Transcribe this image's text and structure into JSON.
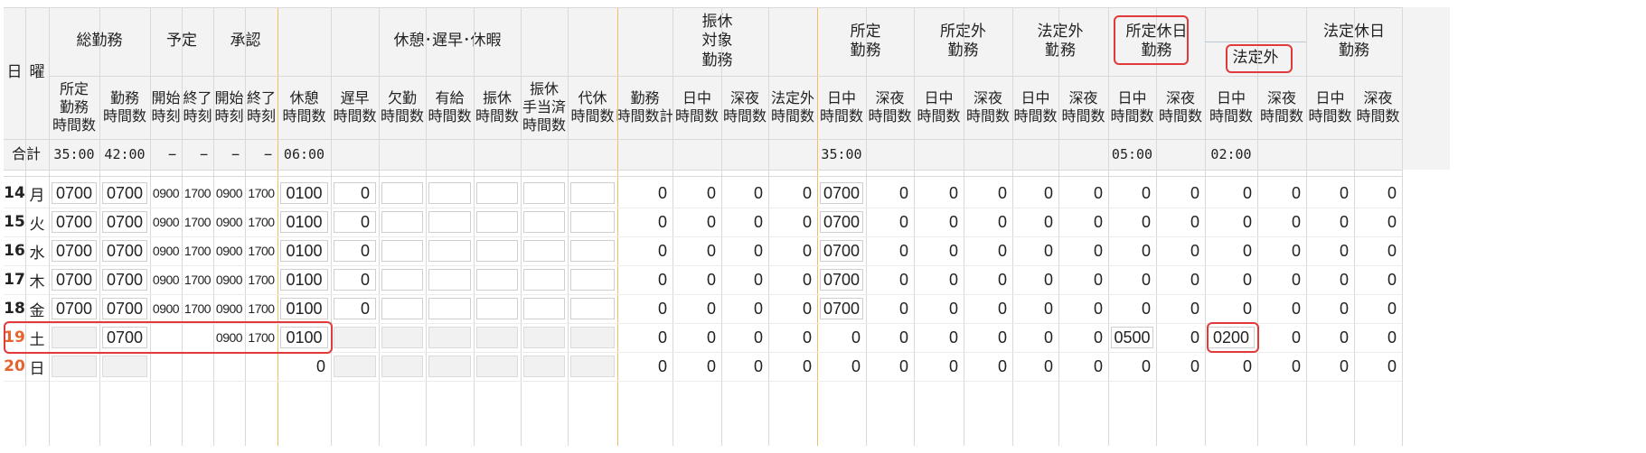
{
  "headers": {
    "day": "日",
    "weekday": "曜",
    "total_work": "総勤務",
    "scheduled": "予定",
    "approval": "承認",
    "breaks": "休憩･遅早･休暇",
    "substitute_target": "振休\n対象\n勤務",
    "prescribed_work": "所定\n勤務",
    "non_prescribed_work": "所定外\n勤務",
    "non_statutory_work": "法定外\n勤務",
    "prescribed_holiday_work": "所定休日\n勤務",
    "hol_non_statutory": "法定外",
    "statutory_holiday_work": "法定休日\n勤務",
    "sub": {
      "prescribed_hours": "所定\n勤務\n時間数",
      "work_hours": "勤務\n時間数",
      "start_time": "開始\n時刻",
      "end_time": "終了\n時刻",
      "break_hours": "休憩\n時間数",
      "late_hours": "遅早\n時間数",
      "absence_hours": "欠勤\n時間数",
      "paid_hours": "有給\n時間数",
      "sub_hol_hours": "振休\n時間数",
      "sub_hol_allowance": "振休\n手当済\n時間数",
      "comp_hours": "代休\n時間数",
      "work_hours_total": "勤務\n時間数計",
      "day_hours": "日中\n時間数",
      "night_hours": "深夜\n時間数",
      "non_statutory_hours": "法定外\n時間数"
    }
  },
  "totals": {
    "label": "合計",
    "prescribed": "35:00",
    "work": "42:00",
    "dash": "−",
    "break": "06:00",
    "prescribed_day": "35:00",
    "holiday_day": "05:00",
    "holiday_ns_day": "02:00"
  },
  "rows": [
    {
      "day": "14",
      "wd": "月",
      "prescribed": "0700",
      "work": "0700",
      "ps": "0900",
      "pe": "1700",
      "as": "0900",
      "ae": "1700",
      "brk": "0100",
      "late": "0",
      "c": [
        "0",
        "0",
        "0",
        "0",
        "0700",
        "0",
        "0",
        "0",
        "0",
        "0",
        "0",
        "0",
        "0",
        "0",
        "0",
        "0"
      ]
    },
    {
      "day": "15",
      "wd": "火",
      "prescribed": "0700",
      "work": "0700",
      "ps": "0900",
      "pe": "1700",
      "as": "0900",
      "ae": "1700",
      "brk": "0100",
      "late": "0",
      "c": [
        "0",
        "0",
        "0",
        "0",
        "0700",
        "0",
        "0",
        "0",
        "0",
        "0",
        "0",
        "0",
        "0",
        "0",
        "0",
        "0"
      ]
    },
    {
      "day": "16",
      "wd": "水",
      "prescribed": "0700",
      "work": "0700",
      "ps": "0900",
      "pe": "1700",
      "as": "0900",
      "ae": "1700",
      "brk": "0100",
      "late": "0",
      "c": [
        "0",
        "0",
        "0",
        "0",
        "0700",
        "0",
        "0",
        "0",
        "0",
        "0",
        "0",
        "0",
        "0",
        "0",
        "0",
        "0"
      ]
    },
    {
      "day": "17",
      "wd": "木",
      "prescribed": "0700",
      "work": "0700",
      "ps": "0900",
      "pe": "1700",
      "as": "0900",
      "ae": "1700",
      "brk": "0100",
      "late": "0",
      "c": [
        "0",
        "0",
        "0",
        "0",
        "0700",
        "0",
        "0",
        "0",
        "0",
        "0",
        "0",
        "0",
        "0",
        "0",
        "0",
        "0"
      ]
    },
    {
      "day": "18",
      "wd": "金",
      "prescribed": "0700",
      "work": "0700",
      "ps": "0900",
      "pe": "1700",
      "as": "0900",
      "ae": "1700",
      "brk": "0100",
      "late": "0",
      "c": [
        "0",
        "0",
        "0",
        "0",
        "0700",
        "0",
        "0",
        "0",
        "0",
        "0",
        "0",
        "0",
        "0",
        "0",
        "0",
        "0"
      ]
    },
    {
      "day": "19",
      "wd": "土",
      "prescribed": "",
      "work": "0700",
      "ps": "",
      "pe": "",
      "as": "0900",
      "ae": "1700",
      "brk": "0100",
      "late": "",
      "c": [
        "0",
        "0",
        "0",
        "0",
        "0",
        "0",
        "0",
        "0",
        "0",
        "0",
        "0500",
        "0",
        "0200",
        "0",
        "0",
        "0"
      ]
    },
    {
      "day": "20",
      "wd": "日",
      "prescribed": "",
      "work": "",
      "ps": "",
      "pe": "",
      "as": "",
      "ae": "",
      "brk": "0",
      "late": "",
      "c": [
        "0",
        "0",
        "0",
        "0",
        "0",
        "0",
        "0",
        "0",
        "0",
        "0",
        "0",
        "0",
        "0",
        "0",
        "0",
        "0"
      ]
    }
  ],
  "colors": {
    "highlight_red": "#e23a3a",
    "weekend_day": "#e6632e",
    "grid": "#d6d6d6",
    "section_line": "#f0c060"
  }
}
